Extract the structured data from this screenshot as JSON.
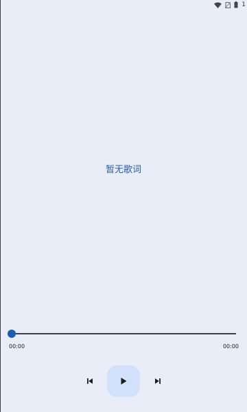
{
  "status_bar": {
    "icons": [
      "wifi-icon",
      "sim-off-icon",
      "battery-icon"
    ],
    "time_fragment": "1"
  },
  "lyrics": {
    "empty_text": "暂无歌词"
  },
  "player": {
    "elapsed": "00:00",
    "total": "00:00",
    "progress_fraction": 0,
    "controls": [
      "previous-icon",
      "play-icon",
      "next-icon"
    ]
  },
  "colors": {
    "background": "#e8edf8",
    "accent": "#1a5fb4",
    "lyrics_text": "#2a5ea8",
    "play_button_bg": "#d3e2fb"
  }
}
